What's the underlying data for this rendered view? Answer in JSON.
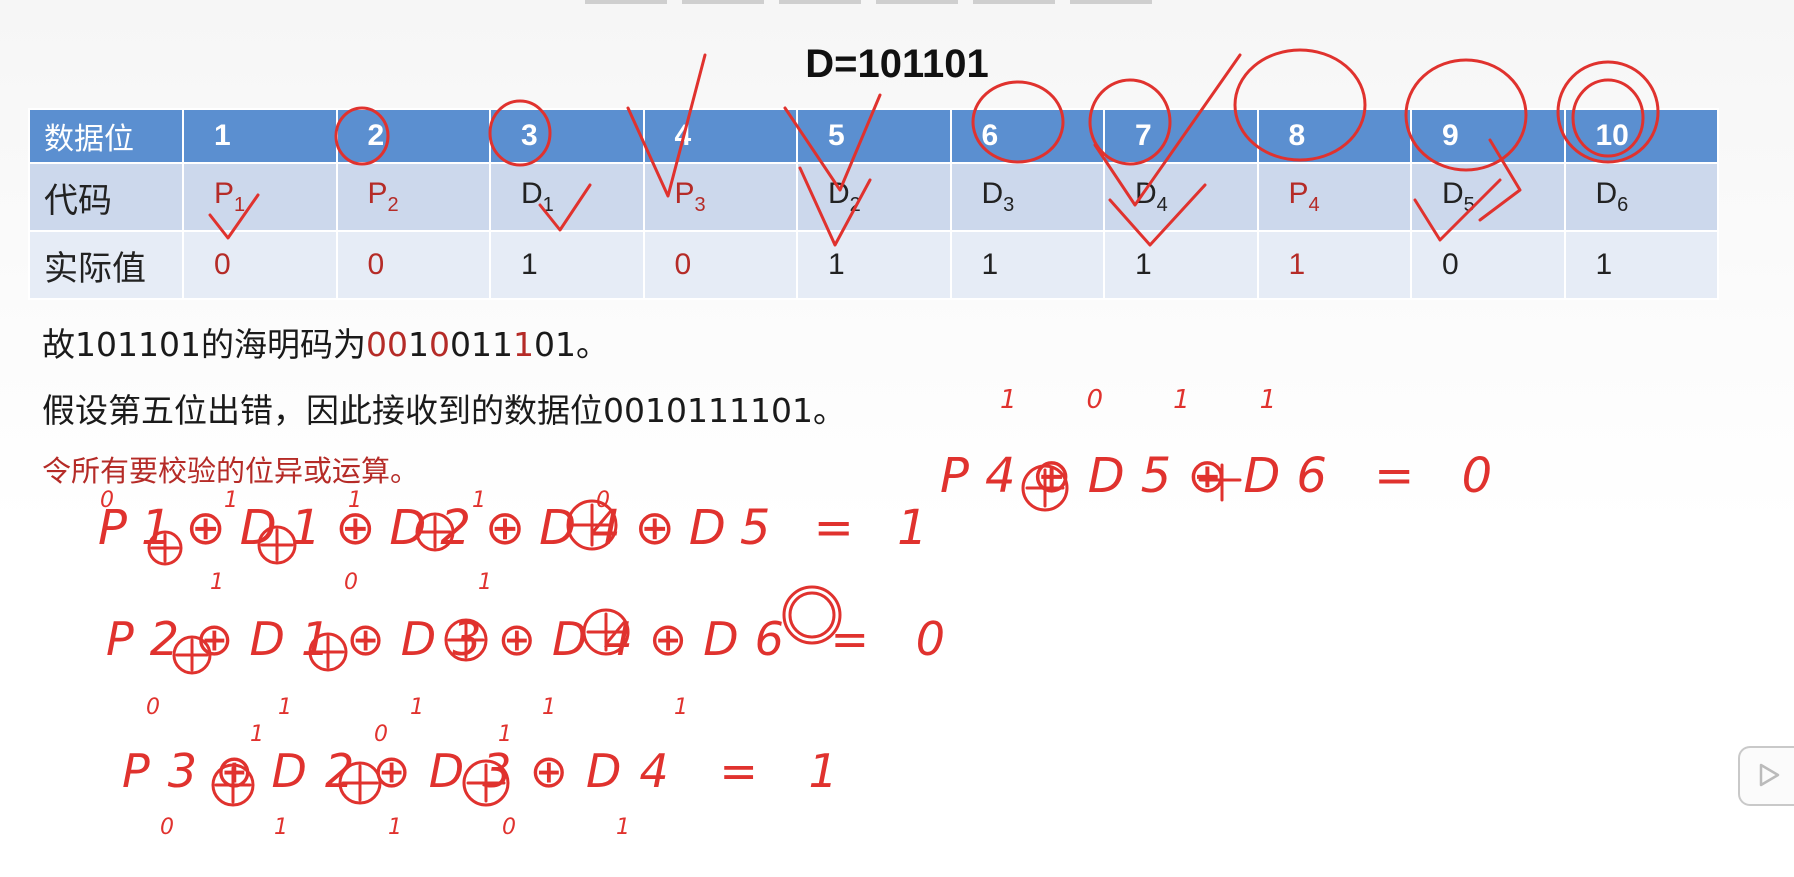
{
  "title": "D=101101",
  "table": {
    "header_label": "数据位",
    "positions": [
      "1",
      "2",
      "3",
      "4",
      "5",
      "6",
      "7",
      "8",
      "9",
      "10"
    ],
    "code_label": "代码",
    "codes": [
      {
        "main": "P",
        "sub": "1",
        "parity": true
      },
      {
        "main": "P",
        "sub": "2",
        "parity": true
      },
      {
        "main": "D",
        "sub": "1",
        "parity": false
      },
      {
        "main": "P",
        "sub": "3",
        "parity": true
      },
      {
        "main": "D",
        "sub": "2",
        "parity": false
      },
      {
        "main": "D",
        "sub": "3",
        "parity": false
      },
      {
        "main": "D",
        "sub": "4",
        "parity": false
      },
      {
        "main": "P",
        "sub": "4",
        "parity": true
      },
      {
        "main": "D",
        "sub": "5",
        "parity": false
      },
      {
        "main": "D",
        "sub": "6",
        "parity": false
      }
    ],
    "value_label": "实际值",
    "values": [
      "0",
      "0",
      "1",
      "0",
      "1",
      "1",
      "1",
      "1",
      "0",
      "1"
    ]
  },
  "line1": {
    "prefix": "故101101的海明码为",
    "code_segments": [
      {
        "text": "00",
        "red": true
      },
      {
        "text": "1",
        "red": false
      },
      {
        "text": "0",
        "red": true
      },
      {
        "text": "011",
        "red": false
      },
      {
        "text": "1",
        "red": true
      },
      {
        "text": "01",
        "red": false
      }
    ],
    "suffix": "。"
  },
  "line2": "假设第五位出错，因此接收到的数据位0010111101。",
  "line3": "令所有要校验的位异或运算。",
  "handwriting": {
    "eq1": {
      "text": "P1⊕D1⊕D2⊕D4⊕D5 = 1",
      "above": [
        "0",
        "1",
        "1",
        "1",
        "0"
      ],
      "below": [
        "1",
        "0",
        "1"
      ]
    },
    "eq2": {
      "text": "P2⊕D1⊕D3⊕D4⊕D6 = 0",
      "below": [
        "0",
        "1",
        "1",
        "1",
        "1"
      ]
    },
    "eq3": {
      "text": "P3⊕D2⊕D3⊕D4 = 1",
      "above": [
        "1",
        "0",
        "1"
      ],
      "below": [
        "0",
        "1",
        "1",
        "0",
        "1"
      ]
    },
    "eq4": {
      "text": "P4⊕D5⊕D6 = 0",
      "above": [
        "1",
        "0",
        "1",
        "1"
      ]
    }
  },
  "ui": {
    "play_icon": "play-icon"
  }
}
